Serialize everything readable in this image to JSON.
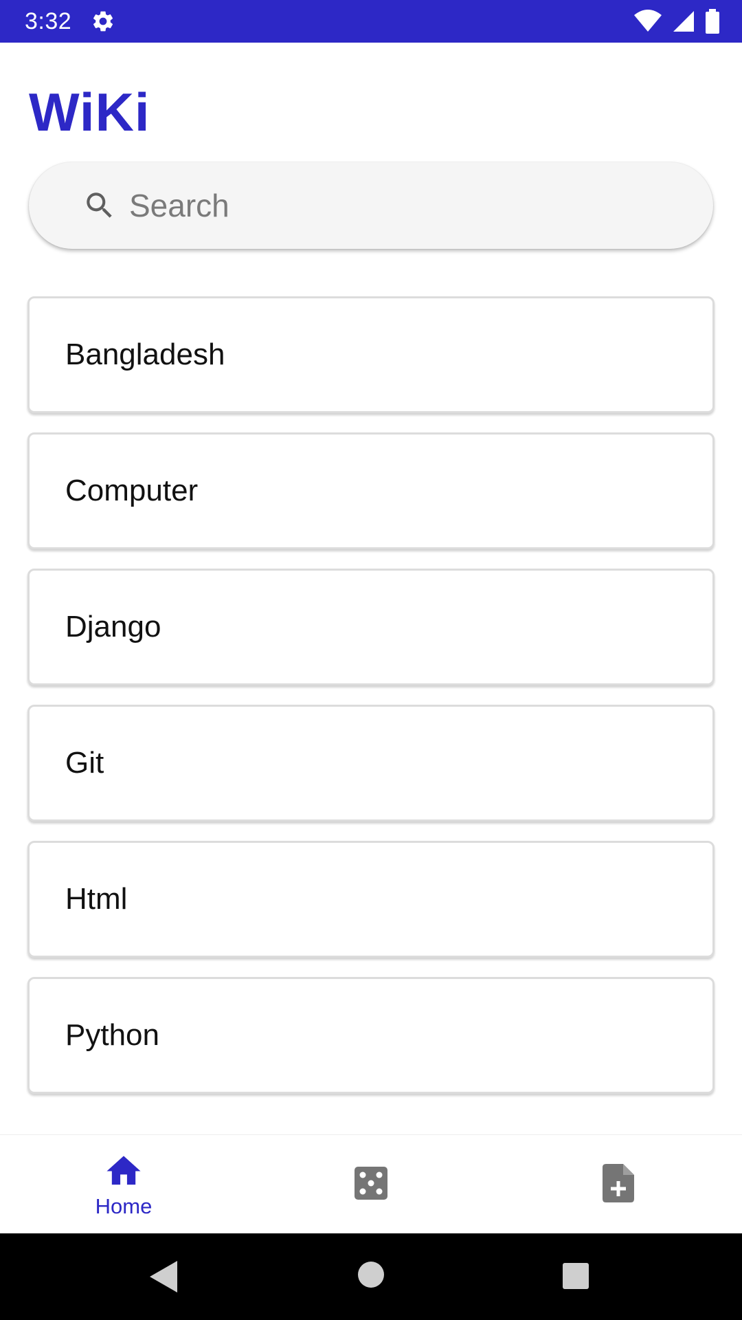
{
  "status_bar": {
    "time": "3:32",
    "icons": [
      "settings-icon",
      "wifi-icon",
      "signal-icon",
      "battery-icon"
    ],
    "background": "#2d28c6"
  },
  "app": {
    "title": "WiKi",
    "accent_color": "#2d28c6"
  },
  "search": {
    "placeholder": "Search",
    "value": "",
    "icon": "search-icon"
  },
  "articles": [
    {
      "label": "Bangladesh"
    },
    {
      "label": "Computer"
    },
    {
      "label": "Django"
    },
    {
      "label": "Git"
    },
    {
      "label": "Html"
    },
    {
      "label": "Python"
    }
  ],
  "bottom_nav": {
    "items": [
      {
        "label": "Home",
        "icon": "home-icon",
        "selected": true
      },
      {
        "label": "",
        "icon": "dice-icon",
        "selected": false
      },
      {
        "label": "",
        "icon": "add-document-icon",
        "selected": false
      }
    ]
  },
  "system_nav": {
    "icons": [
      "back-icon",
      "home-circle-icon",
      "recents-icon"
    ]
  }
}
